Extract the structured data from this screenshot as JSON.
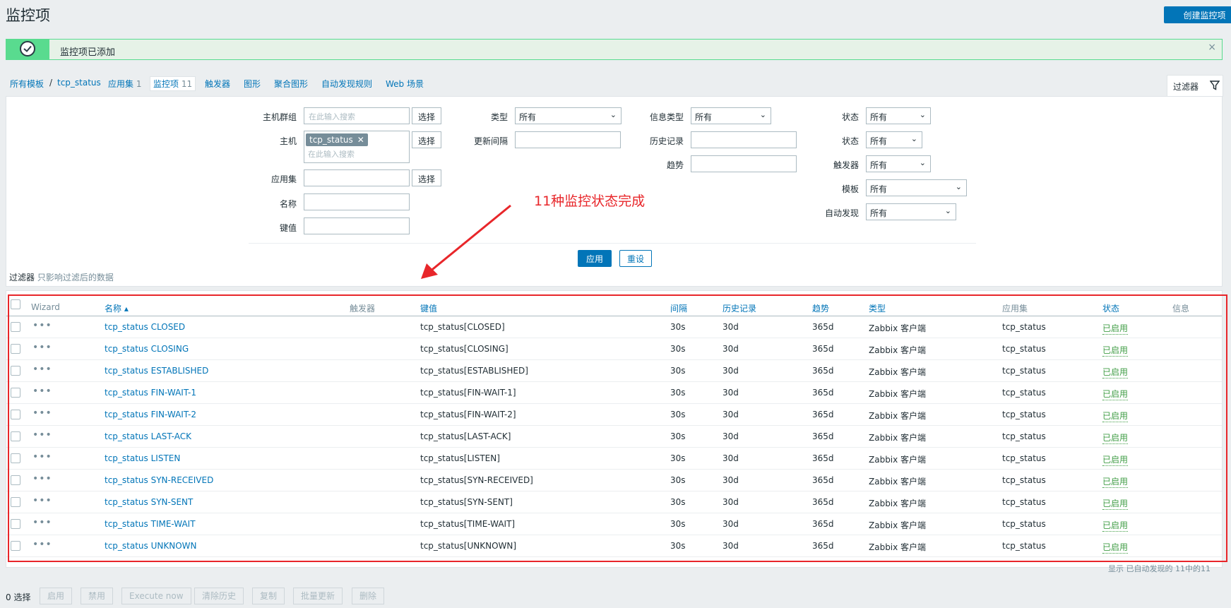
{
  "header": {
    "title": "监控项",
    "create_label": "创建监控项"
  },
  "message": {
    "text": "监控项已添加",
    "close": "×"
  },
  "nav": {
    "all_templates": "所有模板",
    "separator": "/",
    "template": "tcp_status",
    "applications": "应用集",
    "applications_count": "1",
    "items": "监控项",
    "items_count": "11",
    "triggers": "触发器",
    "graphs": "图形",
    "screens": "聚合图形",
    "discovery": "自动发现规则",
    "web": "Web 场景"
  },
  "filter": {
    "tab_label": "过滤器",
    "host_group_label": "主机群组",
    "host_group_placeholder": "在此输入搜索",
    "select_label": "选择",
    "host_label": "主机",
    "host_tag": "tcp_status",
    "host_placeholder": "在此输入搜索",
    "app_label": "应用集",
    "name_label": "名称",
    "key_label": "键值",
    "type_label": "类型",
    "type_value": "所有",
    "interval_label": "更新间隔",
    "info_type_label": "信息类型",
    "info_type_value": "所有",
    "history_label": "历史记录",
    "trends_label": "趋势",
    "state_label": "状态",
    "state_value": "所有",
    "status_label": "状态",
    "status_value": "所有",
    "triggers_label": "触发器",
    "triggers_value": "所有",
    "template_label": "模板",
    "template_value": "所有",
    "discovered_label": "自动发现",
    "discovered_value": "所有",
    "apply": "应用",
    "reset": "重设",
    "note": "过滤器",
    "note_sub": "只影响过滤后的数据"
  },
  "annotation": {
    "text": "11种监控状态完成"
  },
  "table": {
    "columns": {
      "wizard": "Wizard",
      "name": "名称 ▴",
      "triggers": "触发器",
      "key": "键值",
      "interval": "间隔",
      "history": "历史记录",
      "trends": "趋势",
      "type": "类型",
      "applications": "应用集",
      "status": "状态",
      "info": "信息"
    },
    "rows": [
      {
        "name": "tcp_status CLOSED",
        "key": "tcp_status[CLOSED]",
        "interval": "30s",
        "history": "30d",
        "trends": "365d",
        "type": "Zabbix 客户端",
        "app": "tcp_status",
        "status": "已启用"
      },
      {
        "name": "tcp_status CLOSING",
        "key": "tcp_status[CLOSING]",
        "interval": "30s",
        "history": "30d",
        "trends": "365d",
        "type": "Zabbix 客户端",
        "app": "tcp_status",
        "status": "已启用"
      },
      {
        "name": "tcp_status ESTABLISHED",
        "key": "tcp_status[ESTABLISHED]",
        "interval": "30s",
        "history": "30d",
        "trends": "365d",
        "type": "Zabbix 客户端",
        "app": "tcp_status",
        "status": "已启用"
      },
      {
        "name": "tcp_status FIN-WAIT-1",
        "key": "tcp_status[FIN-WAIT-1]",
        "interval": "30s",
        "history": "30d",
        "trends": "365d",
        "type": "Zabbix 客户端",
        "app": "tcp_status",
        "status": "已启用"
      },
      {
        "name": "tcp_status FIN-WAIT-2",
        "key": "tcp_status[FIN-WAIT-2]",
        "interval": "30s",
        "history": "30d",
        "trends": "365d",
        "type": "Zabbix 客户端",
        "app": "tcp_status",
        "status": "已启用"
      },
      {
        "name": "tcp_status LAST-ACK",
        "key": "tcp_status[LAST-ACK]",
        "interval": "30s",
        "history": "30d",
        "trends": "365d",
        "type": "Zabbix 客户端",
        "app": "tcp_status",
        "status": "已启用"
      },
      {
        "name": "tcp_status LISTEN",
        "key": "tcp_status[LISTEN]",
        "interval": "30s",
        "history": "30d",
        "trends": "365d",
        "type": "Zabbix 客户端",
        "app": "tcp_status",
        "status": "已启用"
      },
      {
        "name": "tcp_status SYN-RECEIVED",
        "key": "tcp_status[SYN-RECEIVED]",
        "interval": "30s",
        "history": "30d",
        "trends": "365d",
        "type": "Zabbix 客户端",
        "app": "tcp_status",
        "status": "已启用"
      },
      {
        "name": "tcp_status SYN-SENT",
        "key": "tcp_status[SYN-SENT]",
        "interval": "30s",
        "history": "30d",
        "trends": "365d",
        "type": "Zabbix 客户端",
        "app": "tcp_status",
        "status": "已启用"
      },
      {
        "name": "tcp_status TIME-WAIT",
        "key": "tcp_status[TIME-WAIT]",
        "interval": "30s",
        "history": "30d",
        "trends": "365d",
        "type": "Zabbix 客户端",
        "app": "tcp_status",
        "status": "已启用"
      },
      {
        "name": "tcp_status UNKNOWN",
        "key": "tcp_status[UNKNOWN]",
        "interval": "30s",
        "history": "30d",
        "trends": "365d",
        "type": "Zabbix 客户端",
        "app": "tcp_status",
        "status": "已启用"
      }
    ],
    "stats": "显示 已自动发现的 11中的11"
  },
  "footer": {
    "selected": "0 选择",
    "enable": "启用",
    "disable": "禁用",
    "execute": "Execute now",
    "clear_history": "清除历史",
    "copy": "复制",
    "mass_update": "批量更新",
    "delete": "删除"
  },
  "colors": {
    "accent": "#0275b8",
    "success": "#59db8f",
    "enabled": "#429e47",
    "annotation": "#e8262a"
  }
}
